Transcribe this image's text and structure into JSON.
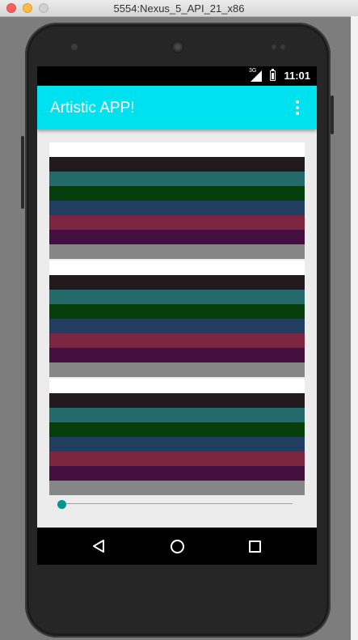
{
  "window": {
    "title": "5554:Nexus_5_API_21_x86"
  },
  "status_bar": {
    "network_label": "3G",
    "time": "11:01"
  },
  "app_bar": {
    "title": "Artistic APP!",
    "overflow_icon": "more-vert-icon"
  },
  "art_panels": [
    {
      "stripes": [
        "#221a1d",
        "#246a6a",
        "#073f0c",
        "#213e60",
        "#7c2540",
        "#420f3f",
        "#868686"
      ]
    },
    {
      "stripes": [
        "#221a1d",
        "#246a6a",
        "#073f0c",
        "#213e60",
        "#7c2540",
        "#420f3f",
        "#868686"
      ]
    },
    {
      "stripes": [
        "#221a1d",
        "#246a6a",
        "#073f0c",
        "#213e60",
        "#7c2540",
        "#420f3f",
        "#868686"
      ]
    }
  ],
  "seekbar": {
    "value": 0,
    "max": 100,
    "accent": "#009688"
  },
  "nav_bar": {
    "back_icon": "back-triangle-icon",
    "home_icon": "home-circle-icon",
    "recents_icon": "recents-square-icon"
  },
  "colors": {
    "app_bar": "#00e1ef",
    "content_bg": "#ececec"
  }
}
